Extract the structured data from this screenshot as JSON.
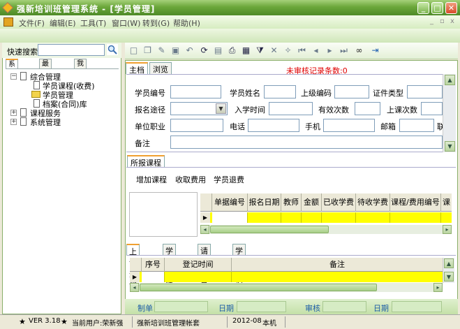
{
  "window": {
    "title": "强新培训班管理系统 - [学员管理]"
  },
  "menu": [
    "文件(F)",
    "编辑(E)",
    "工具(T)",
    "窗口(W)",
    "转到(G)",
    "帮助(H)"
  ],
  "quick_search": {
    "label": "快速搜索",
    "value": ""
  },
  "left_tabs": [
    "系统菜单",
    "最新资讯",
    "我的喜好"
  ],
  "tree": {
    "items": [
      {
        "label": "综合管理"
      },
      {
        "label": "学员课程(收费)"
      },
      {
        "label": "学员管理"
      },
      {
        "label": "档案(合同)库"
      },
      {
        "label": "课程服务"
      },
      {
        "label": "系统管理"
      }
    ]
  },
  "main_tabs": [
    "主档",
    "浏览"
  ],
  "warning_text": "未审核记录条数:0",
  "form": {
    "student_no": "学员编号",
    "student_name": "学员姓名",
    "upper_code": "上级编码",
    "id_type": "证件类型",
    "enroll_channel": "报名途径",
    "enroll_time": "入学时间",
    "valid_count": "有效次数",
    "class_count": "上课次数",
    "employer": "单位职业",
    "phone": "电话",
    "mobile": "手机",
    "email": "邮箱",
    "email_overflow": "联",
    "remark": "备注"
  },
  "courses_section": {
    "tab": "所报课程",
    "actions": [
      "增加课程",
      "收取费用",
      "学员退费"
    ],
    "columns": [
      "单据编号",
      "报名日期",
      "教师",
      "金额",
      "已收学费",
      "待收学费",
      "课程/费用编号",
      "课"
    ]
  },
  "sub_tabs": [
    "上课登记",
    "学习成绩",
    "请假记录",
    "学习情况"
  ],
  "attendance_grid": {
    "columns": [
      "序号",
      "登记时间",
      "备注"
    ]
  },
  "bottom_fields": [
    "制单",
    "日期",
    "审核",
    "日期"
  ],
  "status": {
    "version": "VER 3.18",
    "current_user_label": "当前用户:荣新强",
    "account": "强新培训班管理帐套",
    "period": "2012-08",
    "location": "本机"
  },
  "colors": {
    "title_green": "#6ba73a",
    "grid_row": "#ffff00",
    "warning": "#e00000",
    "bottom_label": "#1f5fa8"
  }
}
